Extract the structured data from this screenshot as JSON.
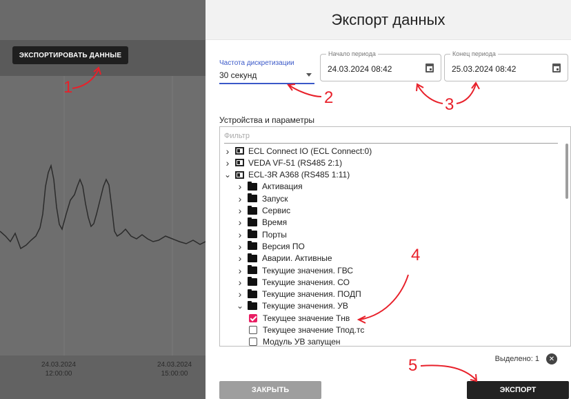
{
  "background": {
    "export_button_label": "ЭКСПОРТИРОВАТЬ ДАННЫЕ",
    "xticks": [
      {
        "date": "24.03.2024",
        "time": "12:00:00"
      },
      {
        "date": "24.03.2024",
        "time": "15:00:00"
      }
    ]
  },
  "annotations": [
    "1",
    "2",
    "3",
    "4",
    "5"
  ],
  "dialog": {
    "title": "Экспорт данных",
    "frequency": {
      "label": "Частота дискретизации",
      "value": "30 секунд"
    },
    "start": {
      "label": "Начало периода",
      "value": "24.03.2024 08:42"
    },
    "end": {
      "label": "Конец периода",
      "value": "25.03.2024 08:42"
    },
    "devices_label": "Устройства и параметры",
    "filter_placeholder": "Фильтр",
    "tree": [
      {
        "label": "ECL Connect IO (ECL Connect:0)",
        "kind": "device",
        "expanded": false
      },
      {
        "label": "VEDA VF-51 (RS485 2:1)",
        "kind": "device",
        "expanded": false
      },
      {
        "label": "ECL-3R A368 (RS485 1:11)",
        "kind": "device",
        "expanded": true
      },
      {
        "label": "Активация",
        "kind": "folder"
      },
      {
        "label": "Запуск",
        "kind": "folder"
      },
      {
        "label": "Сервис",
        "kind": "folder"
      },
      {
        "label": "Время",
        "kind": "folder"
      },
      {
        "label": "Порты",
        "kind": "folder"
      },
      {
        "label": "Версия ПО",
        "kind": "folder"
      },
      {
        "label": "Аварии. Активные",
        "kind": "folder"
      },
      {
        "label": "Текущие значения. ГВС",
        "kind": "folder"
      },
      {
        "label": "Текущие значения. СО",
        "kind": "folder"
      },
      {
        "label": "Текущие значения. ПОДП",
        "kind": "folder"
      },
      {
        "label": "Текущие значения. УВ",
        "kind": "folder",
        "expanded": true
      },
      {
        "label": "Текущее значение Тнв",
        "kind": "param",
        "checked": true
      },
      {
        "label": "Текущее значение Тпод.тс",
        "kind": "param",
        "checked": false
      },
      {
        "label": "Модуль УВ запущен",
        "kind": "param",
        "checked": false
      }
    ],
    "selected_text": "Выделено: 1",
    "close_label": "ЗАКРЫТЬ",
    "export_label": "ЭКСПОРТ"
  },
  "colors": {
    "accent": "#3a58c8",
    "checkbox": "#e91e63",
    "annotation": "#e8202a"
  }
}
